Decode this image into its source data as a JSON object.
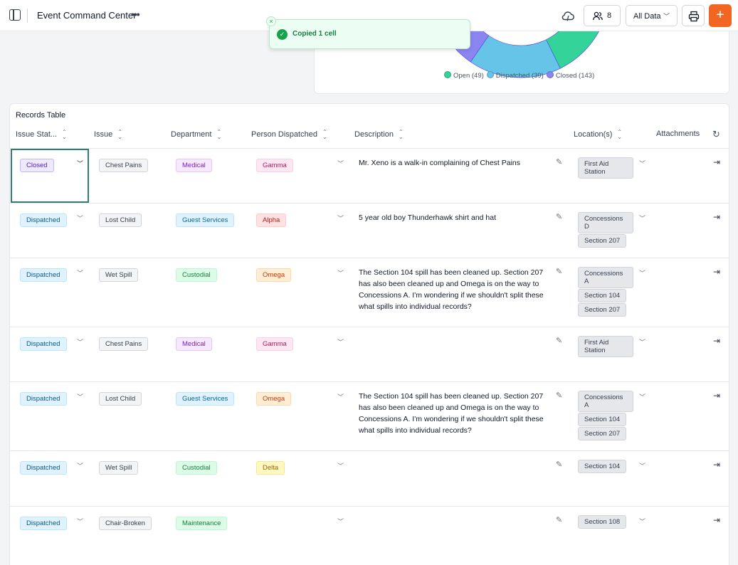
{
  "app": {
    "title": "Event Command Center",
    "user_count": "8",
    "filter_label": "All Data"
  },
  "icons": {
    "sidebar": "sidebar-toggle-icon",
    "more": "more-icon",
    "cloud": "cloud-sync-icon",
    "users": "users-icon",
    "print": "printer-icon",
    "add": "plus-icon"
  },
  "toast": {
    "message": "Copied 1 cell",
    "close": "×",
    "check": "✓"
  },
  "chart_data": {
    "type": "pie",
    "categories": [
      "Open",
      "Dispatched",
      "Closed"
    ],
    "values": [
      49,
      39,
      143
    ],
    "colors": [
      "#34d399",
      "#67c4e9",
      "#8b85f0"
    ],
    "legend": [
      {
        "label": "Open (49)"
      },
      {
        "label": "Dispatched (39)"
      },
      {
        "label": "Closed (143)"
      }
    ]
  },
  "table": {
    "title": "Records Table",
    "headers": {
      "status": "Issue Stat...",
      "issue": "Issue",
      "department": "Department",
      "person": "Person Dispatched",
      "description": "Description",
      "locations": "Location(s)",
      "attachments": "Attachments"
    },
    "rows": [
      {
        "status": "Closed",
        "issue": "Chest Pains",
        "department": "Medical",
        "person": "Gamma",
        "description": "Mr. Xeno is a walk-in complaining of Chest Pains",
        "locations": [
          "First Aid Station"
        ]
      },
      {
        "status": "Dispatched",
        "issue": "Lost Child",
        "department": "Guest Services",
        "person": "Alpha",
        "description": "5 year old boy Thunderhawk shirt and hat",
        "locations": [
          "Concessions D",
          "Section 207"
        ]
      },
      {
        "status": "Dispatched",
        "issue": "Wet Spill",
        "department": "Custodial",
        "person": "Omega",
        "description": "The Section 104 spill has been cleaned up.  Section 207 has also been cleaned up and Omega is on the way to Concessions A. I'm wondering if we shouldn't split these what spills into individual records?",
        "locations": [
          "Concessions A",
          "Section 104",
          "Section 207"
        ]
      },
      {
        "status": "Dispatched",
        "issue": "Chest Pains",
        "department": "Medical",
        "person": "Gamma",
        "description": "",
        "locations": [
          "First Aid Station"
        ]
      },
      {
        "status": "Dispatched",
        "issue": "Lost Child",
        "department": "Guest Services",
        "person": "Omega",
        "description": "The Section 104 spill has been cleaned up.  Section 207 has also been cleaned up and Omega is on the way to Concessions A. I'm wondering if we shouldn't split these what spills into individual records?",
        "locations": [
          "Concessions A",
          "Section 104",
          "Section 207"
        ]
      },
      {
        "status": "Dispatched",
        "issue": "Wet Spill",
        "department": "Custodial",
        "person": "Delta",
        "description": "",
        "locations": [
          "Section 104"
        ]
      },
      {
        "status": "Dispatched",
        "issue": "Chair-Broken",
        "department": "Maintenance",
        "person": "",
        "description": "",
        "locations": [
          "Section 108"
        ]
      }
    ]
  }
}
